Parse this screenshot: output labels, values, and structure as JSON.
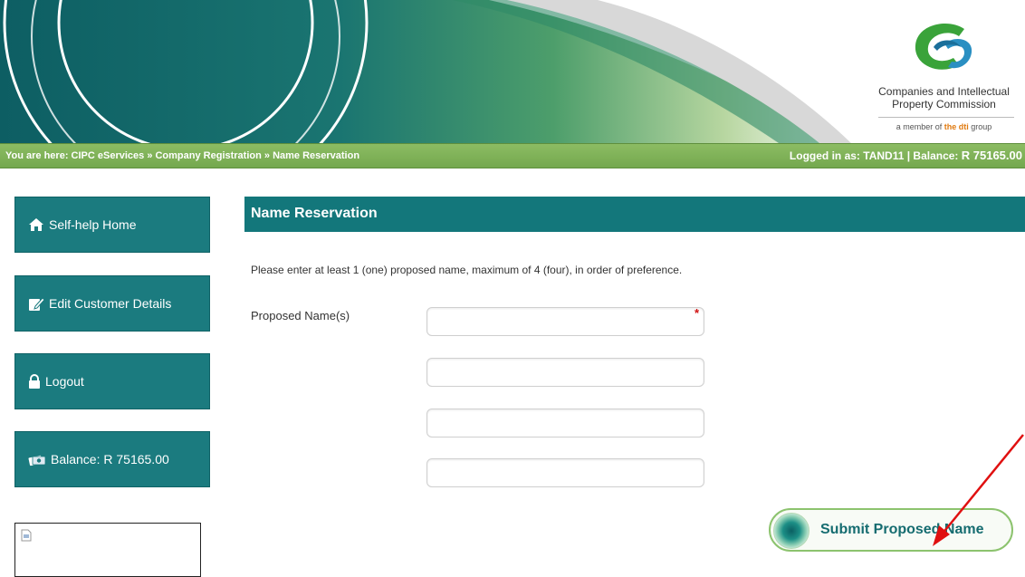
{
  "header": {
    "org_name_line1": "Companies and Intellectual",
    "org_name_line2": "Property Commission",
    "member_prefix": "a member of ",
    "member_brand": "the dti",
    "member_suffix": " group",
    "logo_icon": "cipc-logo-icon"
  },
  "breadcrumb": {
    "text": "You are here: CIPC eServices » Company Registration » Name Reservation",
    "logged_in_prefix": "Logged in as: TAND11 | Balance: ",
    "balance": "R 75165.00"
  },
  "sidebar": {
    "items": [
      {
        "label": "Self-help Home",
        "icon": "home-icon"
      },
      {
        "label": "Edit Customer Details",
        "icon": "edit-icon"
      },
      {
        "label": "Logout",
        "icon": "lock-icon"
      },
      {
        "label": "Balance: R 75165.00",
        "icon": "balance-icon"
      }
    ]
  },
  "main": {
    "title": "Name Reservation",
    "instruction": "Please enter at least 1 (one) proposed name, maximum of 4 (four), in order of preference.",
    "field_label": "Proposed Name(s)",
    "required_marker": "*",
    "inputs": [
      {
        "value": "",
        "placeholder": ""
      },
      {
        "value": "",
        "placeholder": ""
      },
      {
        "value": "",
        "placeholder": ""
      },
      {
        "value": "",
        "placeholder": ""
      }
    ],
    "submit_label": "Submit Proposed Name"
  },
  "colors": {
    "teal": "#13777b",
    "green_bar": "#74a84e",
    "annotation_arrow": "#e01010"
  }
}
